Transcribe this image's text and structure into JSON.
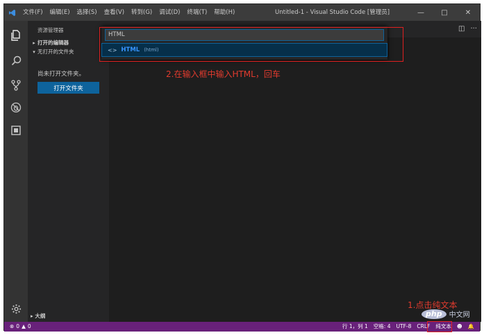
{
  "titlebar": {
    "menu": [
      "文件(F)",
      "编辑(E)",
      "选择(S)",
      "查看(V)",
      "转到(G)",
      "调试(D)",
      "终端(T)",
      "帮助(H)"
    ],
    "window_title": "Untitled-1 - Visual Studio Code [管理员]"
  },
  "sidebar": {
    "title": "资源管理器",
    "open_editors": "打开的编辑器",
    "no_folder_section": "无打开的文件夹",
    "no_folder_message": "尚未打开文件夹。",
    "open_folder_button": "打开文件夹",
    "outline": "大纲"
  },
  "quickpick": {
    "input_value": "HTML",
    "item_label": "HTML",
    "item_desc": "(html)"
  },
  "annotations": {
    "step2": "2.在输入框中输入HTML，回车",
    "step1": "1.点击纯文本"
  },
  "statusbar": {
    "errors": "0",
    "warnings": "0",
    "position": "行 1，列 1",
    "spaces": "空格: 4",
    "encoding": "UTF-8",
    "eol": "CRLF",
    "language": "纯文本"
  },
  "watermark": {
    "logo": "php",
    "text": "中文网"
  },
  "colors": {
    "statusbar": "#68217a",
    "accent": "#0e639c",
    "annotation": "#e23b2e"
  }
}
